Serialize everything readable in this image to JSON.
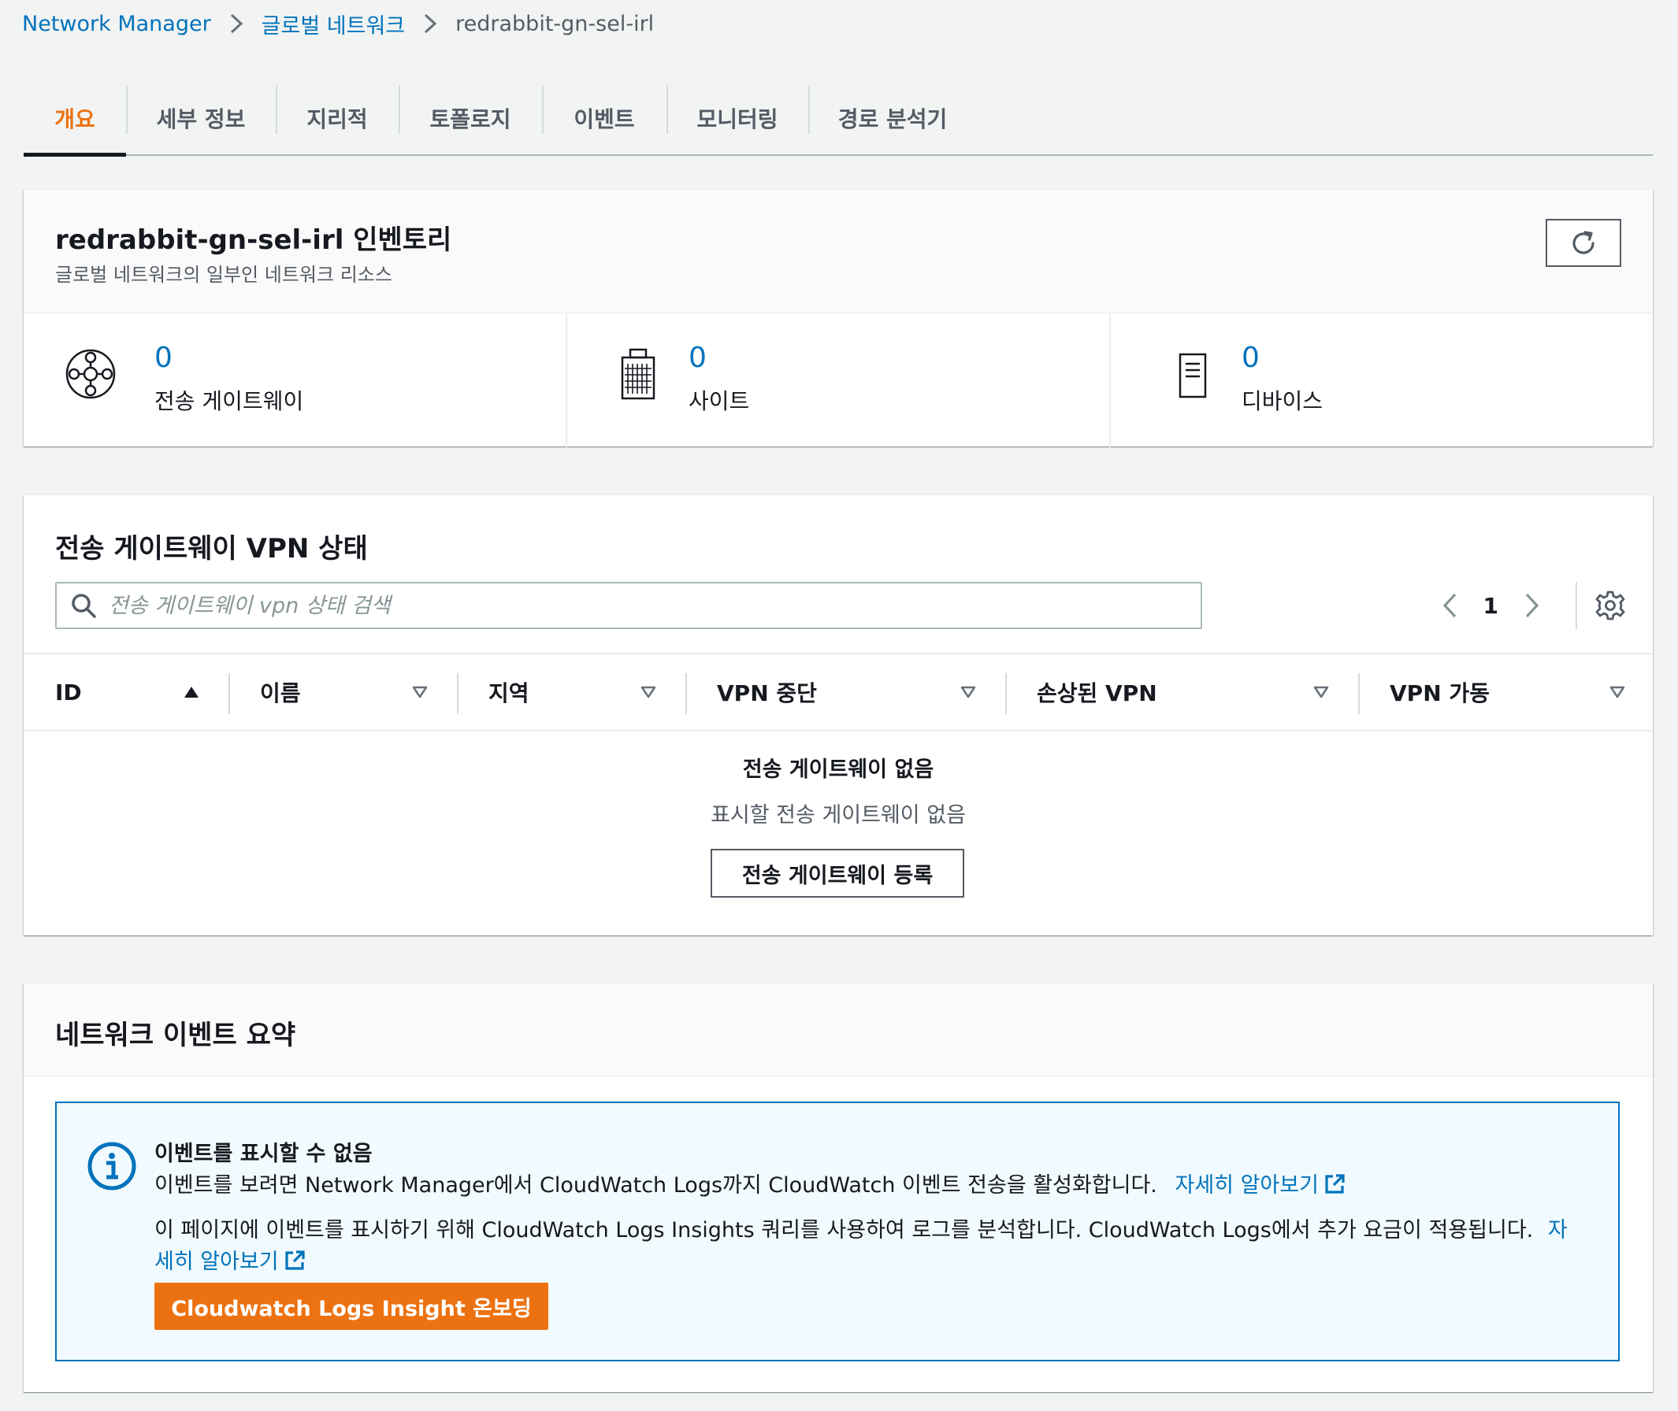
{
  "breadcrumb": {
    "items": [
      "Network Manager",
      "글로벌 네트워크",
      "redrabbit-gn-sel-irl"
    ]
  },
  "tabs": [
    {
      "label": "개요",
      "active": true
    },
    {
      "label": "세부 정보",
      "active": false
    },
    {
      "label": "지리적",
      "active": false
    },
    {
      "label": "토폴로지",
      "active": false
    },
    {
      "label": "이벤트",
      "active": false
    },
    {
      "label": "모니터링",
      "active": false
    },
    {
      "label": "경로 분석기",
      "active": false
    }
  ],
  "inventory": {
    "title": "redrabbit-gn-sel-irl 인벤토리",
    "subtitle": "글로벌 네트워크의 일부인 네트워크 리소스",
    "refresh_icon": "refresh-icon",
    "stats": [
      {
        "value": "0",
        "label": "전송 게이트웨이",
        "icon": "transit-gateway-icon"
      },
      {
        "value": "0",
        "label": "사이트",
        "icon": "building-icon"
      },
      {
        "value": "0",
        "label": "디바이스",
        "icon": "device-icon"
      }
    ]
  },
  "vpn": {
    "title": "전송 게이트웨이 VPN 상태",
    "search_placeholder": "전송 게이트웨이 vpn 상태 검색",
    "page": "1",
    "columns": [
      "ID",
      "이름",
      "지역",
      "VPN 중단",
      "손상된 VPN",
      "VPN 가동"
    ],
    "empty_title": "전송 게이트웨이 없음",
    "empty_sub": "표시할 전송 게이트웨이 없음",
    "register_button": "전송 게이트웨이 등록"
  },
  "events": {
    "title": "네트워크 이벤트 요약",
    "alert_title": "이벤트를 표시할 수 없음",
    "alert_line1": "이벤트를 보려면 Network Manager에서 CloudWatch Logs까지 CloudWatch 이벤트 전송을 활성화합니다.",
    "alert_link1": "자세히 알아보기",
    "alert_line2": "이 페이지에 이벤트를 표시하기 위해 CloudWatch Logs Insights 쿼리를 사용하여 로그를 분석합니다. CloudWatch Logs에서 추가 요금이 적용됩니다.",
    "alert_link2": "자세히 알아보기",
    "onboard_button": "Cloudwatch Logs Insight 온보딩"
  },
  "colors": {
    "accent": "#ec7211",
    "link": "#0073bb",
    "info_bg": "#f1faff"
  }
}
